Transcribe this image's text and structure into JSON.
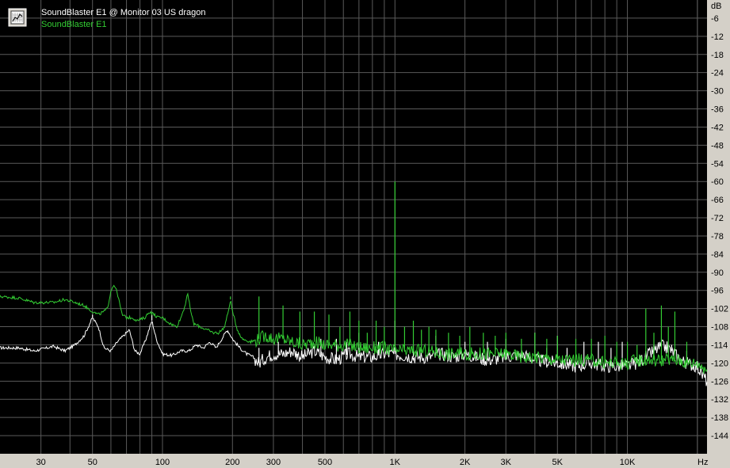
{
  "chart_data": {
    "type": "line",
    "x_scale": "log",
    "y_unit": "dB",
    "x_unit": "Hz",
    "xlim": [
      20,
      22000
    ],
    "ylim": [
      -150,
      0
    ],
    "grid": true,
    "legend_placement": "top-left",
    "y_ticks": [
      "-6",
      "-12",
      "-18",
      "-24",
      "-30",
      "-36",
      "-42",
      "-48",
      "-54",
      "-60",
      "-66",
      "-72",
      "-78",
      "-84",
      "-90",
      "-96",
      "-102",
      "-108",
      "-114",
      "-120",
      "-126",
      "-132",
      "-138",
      "-144"
    ],
    "x_ticks": [
      {
        "label": "30",
        "value": 30
      },
      {
        "label": "50",
        "value": 50
      },
      {
        "label": "100",
        "value": 100
      },
      {
        "label": "200",
        "value": 200
      },
      {
        "label": "300",
        "value": 300
      },
      {
        "label": "500",
        "value": 500
      },
      {
        "label": "1K",
        "value": 1000
      },
      {
        "label": "2K",
        "value": 2000
      },
      {
        "label": "3K",
        "value": 3000
      },
      {
        "label": "5K",
        "value": 5000
      },
      {
        "label": "10K",
        "value": 10000
      }
    ],
    "series": [
      {
        "name": "SoundBlaster E1 @ Monitor 03 US dragon",
        "color": "#ffffff",
        "points": [
          [
            20,
            -115
          ],
          [
            24,
            -115
          ],
          [
            28,
            -116
          ],
          [
            30,
            -115.5
          ],
          [
            34,
            -114.5
          ],
          [
            38,
            -116
          ],
          [
            42,
            -114
          ],
          [
            46,
            -111
          ],
          [
            50,
            -105
          ],
          [
            53,
            -108
          ],
          [
            56,
            -115
          ],
          [
            60,
            -116
          ],
          [
            64,
            -113
          ],
          [
            68,
            -111
          ],
          [
            72,
            -109
          ],
          [
            76,
            -116
          ],
          [
            80,
            -117
          ],
          [
            85,
            -112
          ],
          [
            90,
            -106
          ],
          [
            94,
            -112
          ],
          [
            100,
            -117
          ],
          [
            110,
            -117.5
          ],
          [
            120,
            -116
          ],
          [
            130,
            -116
          ],
          [
            140,
            -114
          ],
          [
            150,
            -115
          ],
          [
            160,
            -113
          ],
          [
            170,
            -115
          ],
          [
            180,
            -112
          ],
          [
            190,
            -109
          ],
          [
            200,
            -112
          ],
          [
            215,
            -115
          ],
          [
            230,
            -117
          ],
          [
            245,
            -118
          ],
          [
            260,
            -120
          ],
          [
            280,
            -118
          ],
          [
            300,
            -117
          ],
          [
            330,
            -117
          ],
          [
            360,
            -116
          ],
          [
            400,
            -118
          ],
          [
            450,
            -116
          ],
          [
            500,
            -118
          ],
          [
            560,
            -119
          ],
          [
            630,
            -117
          ],
          [
            700,
            -118
          ],
          [
            800,
            -118
          ],
          [
            900,
            -117
          ],
          [
            1000,
            -117
          ],
          [
            1200,
            -118
          ],
          [
            1400,
            -118
          ],
          [
            1600,
            -117
          ],
          [
            1800,
            -118
          ],
          [
            2000,
            -117
          ],
          [
            2500,
            -119
          ],
          [
            3000,
            -118
          ],
          [
            3500,
            -117
          ],
          [
            4000,
            -119
          ],
          [
            5000,
            -120
          ],
          [
            6000,
            -121
          ],
          [
            7000,
            -120
          ],
          [
            8000,
            -121
          ],
          [
            9000,
            -121
          ],
          [
            10000,
            -121
          ],
          [
            11000,
            -120
          ],
          [
            12000,
            -118
          ],
          [
            13000,
            -116
          ],
          [
            14000,
            -114.5
          ],
          [
            15000,
            -115
          ],
          [
            16000,
            -117
          ],
          [
            17000,
            -119
          ],
          [
            18000,
            -120
          ],
          [
            20000,
            -121
          ],
          [
            21000,
            -124
          ],
          [
            22000,
            -126
          ]
        ],
        "spikes": [
          [
            50,
            -104
          ],
          [
            90,
            -104
          ],
          [
            191,
            -110
          ],
          [
            260,
            -115
          ],
          [
            315,
            -113
          ],
          [
            380,
            -118
          ],
          [
            420,
            -116
          ],
          [
            480,
            -112
          ],
          [
            560,
            -112
          ],
          [
            620,
            -113
          ],
          [
            700,
            -110
          ],
          [
            850,
            -113
          ],
          [
            1000,
            -106
          ],
          [
            1200,
            -114
          ],
          [
            1500,
            -111
          ],
          [
            2000,
            -113
          ],
          [
            2500,
            -113
          ],
          [
            3000,
            -112
          ],
          [
            4000,
            -110
          ],
          [
            4500,
            -115
          ],
          [
            5000,
            -111
          ],
          [
            5500,
            -115
          ],
          [
            6500,
            -113
          ],
          [
            7500,
            -113
          ],
          [
            8500,
            -115
          ],
          [
            9500,
            -113
          ],
          [
            13000,
            -114
          ],
          [
            14000,
            -113
          ],
          [
            15500,
            -114
          ],
          [
            18000,
            -116
          ]
        ]
      },
      {
        "name": "SoundBlaster E1",
        "color": "#33cc33",
        "points": [
          [
            20,
            -98
          ],
          [
            24,
            -98.5
          ],
          [
            28,
            -100
          ],
          [
            30,
            -100
          ],
          [
            34,
            -100
          ],
          [
            38,
            -99
          ],
          [
            42,
            -100
          ],
          [
            46,
            -101
          ],
          [
            50,
            -103
          ],
          [
            53,
            -104
          ],
          [
            56,
            -103
          ],
          [
            58,
            -102
          ],
          [
            60,
            -96
          ],
          [
            62,
            -94
          ],
          [
            64,
            -97
          ],
          [
            67,
            -104
          ],
          [
            70,
            -105
          ],
          [
            74,
            -105
          ],
          [
            78,
            -106
          ],
          [
            84,
            -105
          ],
          [
            88,
            -103
          ],
          [
            92,
            -104
          ],
          [
            96,
            -105
          ],
          [
            100,
            -105
          ],
          [
            108,
            -107
          ],
          [
            115,
            -108
          ],
          [
            120,
            -105
          ],
          [
            125,
            -101
          ],
          [
            128,
            -97
          ],
          [
            131,
            -101
          ],
          [
            136,
            -107
          ],
          [
            145,
            -108
          ],
          [
            155,
            -109
          ],
          [
            165,
            -110
          ],
          [
            175,
            -110
          ],
          [
            185,
            -108
          ],
          [
            192,
            -103
          ],
          [
            196,
            -99
          ],
          [
            200,
            -103
          ],
          [
            210,
            -109
          ],
          [
            220,
            -112
          ],
          [
            240,
            -113
          ],
          [
            260,
            -112
          ],
          [
            280,
            -111
          ],
          [
            300,
            -112
          ],
          [
            330,
            -112
          ],
          [
            360,
            -113
          ],
          [
            400,
            -114
          ],
          [
            450,
            -113
          ],
          [
            500,
            -114
          ],
          [
            560,
            -114
          ],
          [
            630,
            -114
          ],
          [
            700,
            -115
          ],
          [
            800,
            -115
          ],
          [
            900,
            -115
          ],
          [
            1000,
            -116
          ],
          [
            1200,
            -116
          ],
          [
            1400,
            -116
          ],
          [
            1600,
            -117
          ],
          [
            1800,
            -117
          ],
          [
            2000,
            -117
          ],
          [
            2500,
            -117
          ],
          [
            3000,
            -117
          ],
          [
            3500,
            -118
          ],
          [
            4000,
            -118
          ],
          [
            5000,
            -119
          ],
          [
            6000,
            -119
          ],
          [
            7000,
            -119
          ],
          [
            8000,
            -120
          ],
          [
            9000,
            -120
          ],
          [
            10000,
            -120
          ],
          [
            11000,
            -119
          ],
          [
            12000,
            -119
          ],
          [
            13000,
            -119
          ],
          [
            14000,
            -119
          ],
          [
            15000,
            -119
          ],
          [
            16000,
            -119
          ],
          [
            17000,
            -119
          ],
          [
            18000,
            -120
          ],
          [
            20000,
            -120
          ],
          [
            21000,
            -121
          ],
          [
            22000,
            -122
          ]
        ],
        "spikes": [
          [
            128,
            -97
          ],
          [
            196,
            -98
          ],
          [
            260,
            -98
          ],
          [
            330,
            -101
          ],
          [
            390,
            -103
          ],
          [
            450,
            -103
          ],
          [
            520,
            -104
          ],
          [
            580,
            -108
          ],
          [
            640,
            -103
          ],
          [
            700,
            -106
          ],
          [
            760,
            -110
          ],
          [
            830,
            -106
          ],
          [
            900,
            -108
          ],
          [
            1000,
            -60
          ],
          [
            1100,
            -108
          ],
          [
            1200,
            -106
          ],
          [
            1300,
            -109
          ],
          [
            1400,
            -108
          ],
          [
            1500,
            -109
          ],
          [
            1700,
            -110
          ],
          [
            1900,
            -111
          ],
          [
            2100,
            -108
          ],
          [
            2400,
            -110
          ],
          [
            2700,
            -111
          ],
          [
            3000,
            -110
          ],
          [
            3500,
            -112
          ],
          [
            4000,
            -110
          ],
          [
            4500,
            -112
          ],
          [
            5000,
            -111
          ],
          [
            6000,
            -112
          ],
          [
            7000,
            -112
          ],
          [
            8000,
            -111
          ],
          [
            9000,
            -113
          ],
          [
            10000,
            -113
          ],
          [
            11000,
            -114
          ],
          [
            12000,
            -102
          ],
          [
            13000,
            -110
          ],
          [
            14000,
            -101
          ],
          [
            15000,
            -108
          ],
          [
            16000,
            -103
          ],
          [
            18000,
            -113
          ]
        ]
      }
    ]
  }
}
